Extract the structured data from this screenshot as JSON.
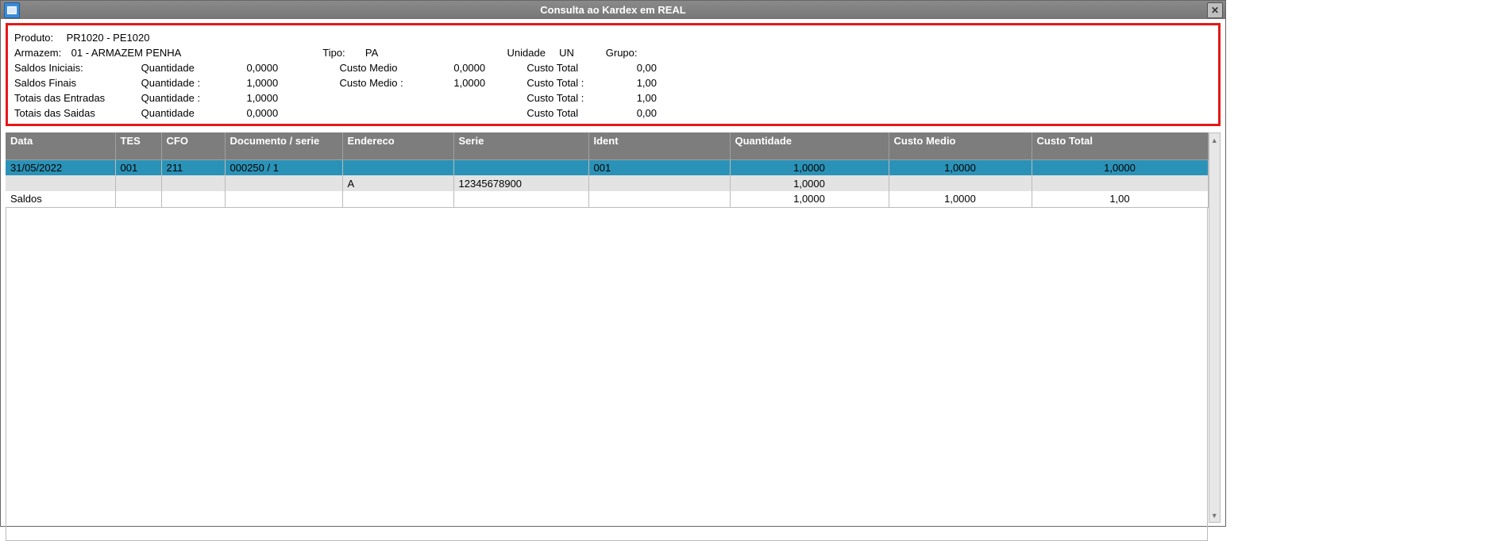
{
  "window": {
    "title": "Consulta ao Kardex em REAL"
  },
  "summary": {
    "produto_label": "Produto:",
    "produto": "PR1020 - PE1020",
    "armazem_label": "Armazem:",
    "armazem": "01 - ARMAZEM PENHA",
    "tipo_label": "Tipo:",
    "tipo": "PA",
    "unidade_label": "Unidade",
    "unidade": "UN",
    "grupo_label": "Grupo:",
    "grupo": "",
    "rows": {
      "iniciais": {
        "label": "Saldos Iniciais:",
        "qtd_label": "Quantidade",
        "qtd": "0,0000",
        "cm_label": "Custo Medio",
        "cm": "0,0000",
        "ct_label": "Custo Total",
        "ct": "0,00"
      },
      "finais": {
        "label": "Saldos Finais",
        "qtd_label": "Quantidade :",
        "qtd": "1,0000",
        "cm_label": "Custo Medio :",
        "cm": "1,0000",
        "ct_label": "Custo Total :",
        "ct": "1,00"
      },
      "entradas": {
        "label": "Totais das Entradas",
        "qtd_label": "Quantidade :",
        "qtd": "1,0000",
        "ct_label": "Custo Total :",
        "ct": "1,00"
      },
      "saidas": {
        "label": "Totais das Saidas",
        "qtd_label": "Quantidade",
        "qtd": "0,0000",
        "ct_label": "Custo Total",
        "ct": "0,00"
      }
    }
  },
  "grid": {
    "headers": {
      "data": "Data",
      "tes": "TES",
      "cfo": "CFO",
      "doc": "Documento / serie",
      "end": "Endereco",
      "serie": "Serie",
      "ident": "Ident",
      "qtd": "Quantidade",
      "cm": "Custo Medio",
      "ct": "Custo Total"
    },
    "rows": [
      {
        "class": "sel",
        "data": "31/05/2022",
        "tes": "001",
        "cfo": "211",
        "doc": "000250    / 1",
        "end": "",
        "serie": "",
        "ident": "001",
        "qtd": "1,0000",
        "cm": "1,0000",
        "ct": "1,0000"
      },
      {
        "class": "alt",
        "data": "",
        "tes": "",
        "cfo": "",
        "doc": "",
        "end": "A",
        "serie": "12345678900",
        "ident": "",
        "qtd": "1,0000",
        "cm": "",
        "ct": ""
      },
      {
        "class": "norm",
        "data": "Saldos",
        "tes": "",
        "cfo": "",
        "doc": "",
        "end": "",
        "serie": "",
        "ident": "",
        "qtd": "1,0000",
        "cm": "1,0000",
        "ct": "1,00"
      }
    ]
  }
}
